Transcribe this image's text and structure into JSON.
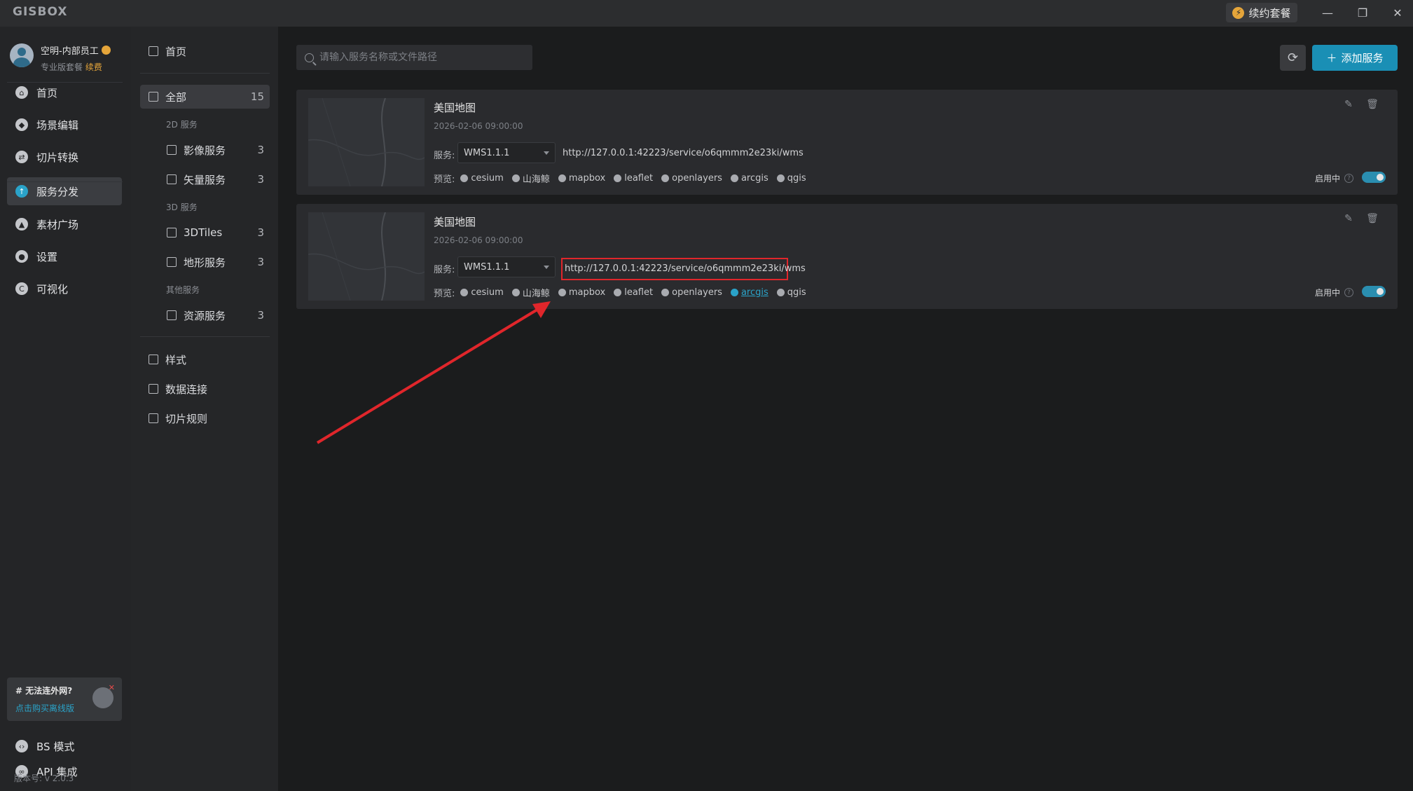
{
  "app": {
    "logo": "GISBOX",
    "renew_label": "续约套餐"
  },
  "user": {
    "name": "空明-内部员工",
    "plan": "专业版套餐",
    "renew": "续费"
  },
  "leftnav": {
    "items": [
      {
        "label": "首页",
        "icon": "home-icon"
      },
      {
        "label": "场景编辑",
        "icon": "cube-icon"
      },
      {
        "label": "切片转换",
        "icon": "swap-icon"
      },
      {
        "label": "服务分发",
        "icon": "upload-icon"
      },
      {
        "label": "素材广场",
        "icon": "image-icon"
      },
      {
        "label": "设置",
        "icon": "gear-icon"
      },
      {
        "label": "可视化",
        "icon": "chart-icon"
      }
    ],
    "promo": {
      "title": "# 无法连外网?",
      "link": "点击购买离线版"
    },
    "bottom": [
      {
        "label": "BS 模式",
        "icon": "code-icon"
      },
      {
        "label": "API 集成",
        "icon": "link-icon"
      }
    ],
    "version": "版本号: v 2.0.3"
  },
  "subnav": {
    "home": "首页",
    "all": {
      "label": "全部",
      "count": "15"
    },
    "group_2d": "2D 服务",
    "imagery": {
      "label": "影像服务",
      "count": "3"
    },
    "vector": {
      "label": "矢量服务",
      "count": "3"
    },
    "group_3d": "3D 服务",
    "tiles3d": {
      "label": "3DTiles",
      "count": "3"
    },
    "terrain": {
      "label": "地形服务",
      "count": "3"
    },
    "group_other": "其他服务",
    "resource": {
      "label": "资源服务",
      "count": "3"
    },
    "style": "样式",
    "dataconn": "数据连接",
    "tilerule": "切片规则"
  },
  "toolbar": {
    "search_placeholder": "请输入服务名称或文件路径",
    "add_label": "添加服务"
  },
  "cards": [
    {
      "title": "美国地图",
      "date": "2026-02-06 09:00:00",
      "service_label": "服务:",
      "protocol": "WMS1.1.1",
      "url": "http://127.0.0.1:42223/service/o6qmmm2e23ki/wms",
      "preview_label": "预览:",
      "previews": [
        "cesium",
        "山海鲸",
        "mapbox",
        "leaflet",
        "openlayers",
        "arcgis",
        "qgis"
      ],
      "status": "启用中",
      "enabled": true
    },
    {
      "title": "美国地图",
      "date": "2026-02-06 09:00:00",
      "service_label": "服务:",
      "protocol": "WMS1.1.1",
      "url": "http://127.0.0.1:42223/service/o6qmmm2e23ki/wms",
      "preview_label": "预览:",
      "previews": [
        "cesium",
        "山海鲸",
        "mapbox",
        "leaflet",
        "openlayers",
        "arcgis",
        "qgis"
      ],
      "status": "启用中",
      "enabled": true
    }
  ],
  "colors": {
    "accent": "#1a8fb5",
    "highlight_box": "#e0262b",
    "arrow": "#e0262b"
  }
}
